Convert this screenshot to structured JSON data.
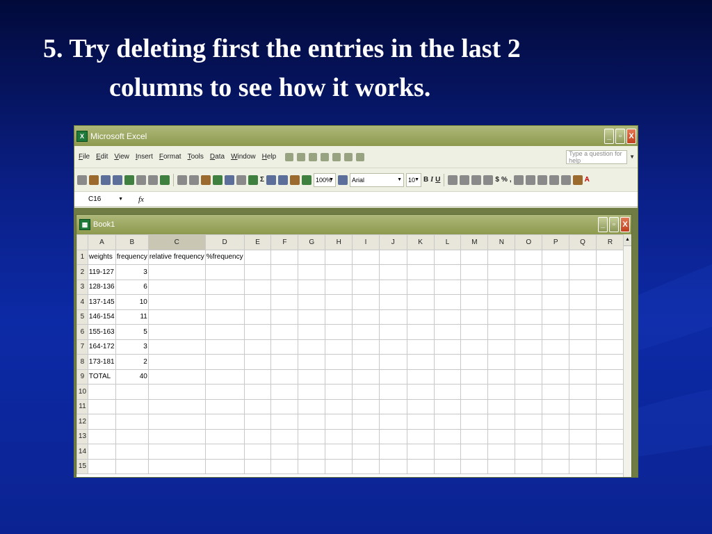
{
  "slide": {
    "title_line1": "5. Try deleting first the entries in the last 2",
    "title_line2": "columns to see how it works."
  },
  "window": {
    "title": "Microsoft Excel",
    "app_icon_text": "X",
    "minimize": "_",
    "restore": "▫",
    "close": "X"
  },
  "menu": {
    "items": [
      "File",
      "Edit",
      "View",
      "Insert",
      "Format",
      "Tools",
      "Data",
      "Window",
      "Help"
    ],
    "help_placeholder": "Type a question for help"
  },
  "toolbar": {
    "zoom": "100%",
    "font": "Arial",
    "font_size": "10",
    "bold": "B",
    "italic": "I",
    "underline": "U",
    "currency": "$",
    "percent": "%",
    "comma": ","
  },
  "formula_bar": {
    "name_box": "C16",
    "fx": "fx",
    "content": ""
  },
  "workbook": {
    "title": "Book1",
    "columns": [
      "A",
      "B",
      "C",
      "D",
      "E",
      "F",
      "G",
      "H",
      "I",
      "J",
      "K",
      "L",
      "M",
      "N",
      "O",
      "P",
      "Q",
      "R"
    ],
    "selected_column": "C",
    "rows": [
      [
        "weights",
        "frequency",
        "relative frequency",
        "%frequency"
      ],
      [
        "119-127",
        "3",
        "",
        ""
      ],
      [
        "128-136",
        "6",
        "",
        ""
      ],
      [
        "137-145",
        "10",
        "",
        ""
      ],
      [
        "146-154",
        "11",
        "",
        ""
      ],
      [
        "155-163",
        "5",
        "",
        ""
      ],
      [
        "164-172",
        "3",
        "",
        ""
      ],
      [
        "173-181",
        "2",
        "",
        ""
      ],
      [
        "TOTAL",
        "40",
        "",
        ""
      ],
      [
        "",
        "",
        "",
        ""
      ],
      [
        "",
        "",
        "",
        ""
      ],
      [
        "",
        "",
        "",
        ""
      ],
      [
        "",
        "",
        "",
        ""
      ],
      [
        "",
        "",
        "",
        ""
      ],
      [
        "",
        "",
        "",
        ""
      ]
    ]
  }
}
